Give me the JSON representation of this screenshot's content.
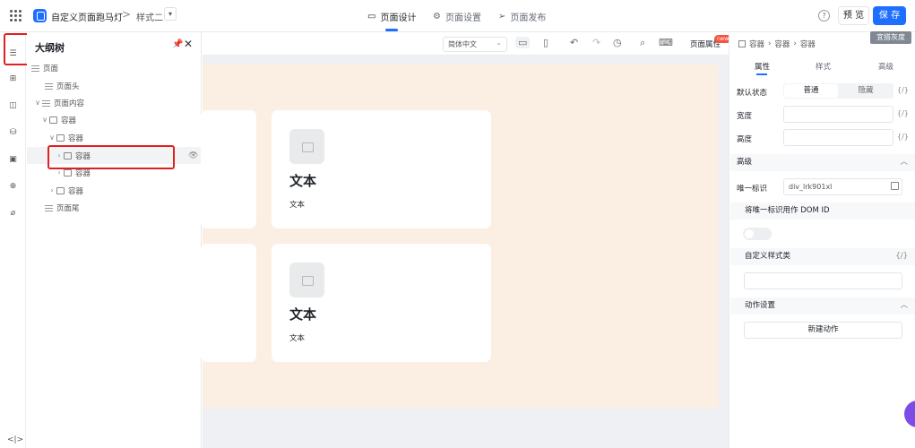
{
  "header": {
    "app_title": "自定义页面跑马灯",
    "crumb_separator": ">",
    "style_name": "样式二",
    "style_caret": "▾",
    "tabs": [
      {
        "label": "页面设计",
        "icon": "layout-icon"
      },
      {
        "label": "页面设置",
        "icon": "gear-icon"
      },
      {
        "label": "页面发布",
        "icon": "send-icon"
      }
    ],
    "help": "?",
    "preview_label": "预 览",
    "save_label": "保 存"
  },
  "outline": {
    "title": "大纲树",
    "pin": "📌",
    "close": "✕",
    "tree": [
      {
        "label": "页面",
        "caret": "",
        "icon": "grid"
      },
      {
        "label": "页面头",
        "caret": "",
        "icon": "grid"
      },
      {
        "label": "页面内容",
        "caret": "∨",
        "icon": "grid"
      },
      {
        "label": "容器",
        "caret": "∨",
        "icon": "box"
      },
      {
        "label": "容器",
        "caret": "∨",
        "icon": "box"
      },
      {
        "label": "容器",
        "caret": "›",
        "icon": "box"
      },
      {
        "label": "容器",
        "caret": "›",
        "icon": "box"
      },
      {
        "label": "容器",
        "caret": "›",
        "icon": "box"
      },
      {
        "label": "页面尾",
        "caret": "",
        "icon": "grid"
      }
    ]
  },
  "rail": {
    "footer": "<|>"
  },
  "canvas": {
    "language": "简体中文",
    "page_props_label": "页面属性",
    "new_badge": "new",
    "cards": [
      {
        "title": "文本",
        "text": "文本"
      },
      {
        "title": "文本",
        "text": "文本"
      }
    ]
  },
  "right_panel": {
    "breadcrumb": [
      "容器",
      "容器",
      "容器"
    ],
    "gray_tag": "宜搭灰度",
    "tabs": [
      "属性",
      "样式",
      "高级"
    ],
    "default_state_label": "默认状态",
    "default_state_options": [
      "普通",
      "隐藏"
    ],
    "expr": "{/}",
    "width_label": "宽度",
    "height_label": "高度",
    "advanced_section": "高级",
    "unique_id_label": "唯一标识",
    "unique_id_value": "div_lrk901xl",
    "use_dom_id_label": "将唯一标识用作 DOM ID",
    "custom_class_label": "自定义样式类",
    "action_section": "动作设置",
    "new_action_label": "新建动作"
  },
  "colors": {
    "accent": "#1e6fff",
    "highlight_border": "#e02020",
    "canvas_page": "#fbeee3"
  }
}
